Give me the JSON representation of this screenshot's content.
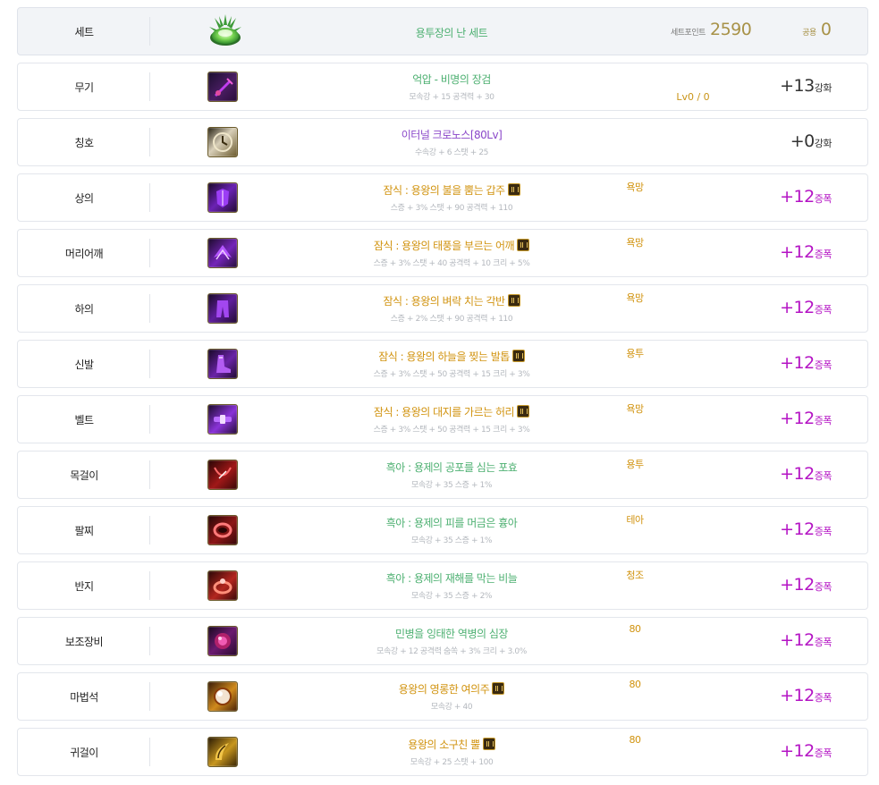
{
  "set": {
    "slot": "세트",
    "name": "용투장의 난 세트",
    "set_point_label": "세트포인트",
    "set_point": "2590",
    "shared_label": "공용",
    "shared": "0",
    "name_color": "#4db071"
  },
  "rows": [
    {
      "slot": "무기",
      "name": "억압 - 비명의 장검",
      "stat": "모속강 + 15 공격력 + 30",
      "tag": "",
      "lv": "Lv0 / 0",
      "plus": "+13",
      "suffix": "강화",
      "level_style": "dark",
      "name_style": "green",
      "badge": false,
      "icon": "sword-icon"
    },
    {
      "slot": "칭호",
      "name": "이터널 크로노스[80Lv]",
      "stat": "수속강 + 6 스탯 + 25",
      "tag": "",
      "lv": "",
      "plus": "+0",
      "suffix": "강화",
      "level_style": "dark",
      "name_style": "purple",
      "badge": false,
      "icon": "clock-icon"
    },
    {
      "slot": "상의",
      "name": "잠식 : 용왕의 불을 뿜는 갑주",
      "stat": "스증 + 3% 스탯 + 90 공격력 + 110",
      "tag": "욕망",
      "lv": "",
      "plus": "+12",
      "suffix": "증폭",
      "level_style": "pink",
      "name_style": "gold",
      "badge": true,
      "icon": "armor-icon"
    },
    {
      "slot": "머리어깨",
      "name": "잠식 : 용왕의 태풍을 부르는 어깨",
      "stat": "스증 + 3% 스탯 + 40 공격력 + 10 크리 + 5%",
      "tag": "욕망",
      "lv": "",
      "plus": "+12",
      "suffix": "증폭",
      "level_style": "pink",
      "name_style": "gold",
      "badge": true,
      "icon": "shoulder-icon"
    },
    {
      "slot": "하의",
      "name": "잠식 : 용왕의 벼락 치는 각반",
      "stat": "스증 + 2% 스탯 + 90 공격력 + 110",
      "tag": "욕망",
      "lv": "",
      "plus": "+12",
      "suffix": "증폭",
      "level_style": "pink",
      "name_style": "gold",
      "badge": true,
      "icon": "pants-icon"
    },
    {
      "slot": "신발",
      "name": "잠식 : 용왕의 하늘을 찢는 발톱",
      "stat": "스증 + 3% 스탯 + 50 공격력 + 15 크리 + 3%",
      "tag": "용투",
      "lv": "",
      "plus": "+12",
      "suffix": "증폭",
      "level_style": "pink",
      "name_style": "gold",
      "badge": true,
      "icon": "boots-icon"
    },
    {
      "slot": "벨트",
      "name": "잠식 : 용왕의 대지를 가르는 허리",
      "stat": "스증 + 3% 스탯 + 50 공격력 + 15 크리 + 3%",
      "tag": "욕망",
      "lv": "",
      "plus": "+12",
      "suffix": "증폭",
      "level_style": "pink",
      "name_style": "gold",
      "badge": true,
      "icon": "belt-icon"
    },
    {
      "slot": "목걸이",
      "name": "흑아 : 용제의 공포를 심는 포효",
      "stat": "모속강 + 35 스증 + 1%",
      "tag": "용투",
      "lv": "",
      "plus": "+12",
      "suffix": "증폭",
      "level_style": "pink",
      "name_style": "green",
      "badge": false,
      "icon": "necklace-icon"
    },
    {
      "slot": "팔찌",
      "name": "흑아 : 용제의 피를 머금은 흉아",
      "stat": "모속강 + 35 스증 + 1%",
      "tag": "테아",
      "lv": "",
      "plus": "+12",
      "suffix": "증폭",
      "level_style": "pink",
      "name_style": "green",
      "badge": false,
      "icon": "bracelet-icon"
    },
    {
      "slot": "반지",
      "name": "흑아 : 용제의 재해를 막는 비늘",
      "stat": "모속강 + 35 스증 + 2%",
      "tag": "청조",
      "lv": "",
      "plus": "+12",
      "suffix": "증폭",
      "level_style": "pink",
      "name_style": "green",
      "badge": false,
      "icon": "ring-icon"
    },
    {
      "slot": "보조장비",
      "name": "민병을 잉태한 역병의 심장",
      "stat": "모속강 + 12 공격력 숨쏙 + 3% 크리 + 3.0%",
      "tag": "80",
      "lv": "",
      "plus": "+12",
      "suffix": "증폭",
      "level_style": "pink",
      "name_style": "green",
      "badge": false,
      "icon": "heart-icon"
    },
    {
      "slot": "마법석",
      "name": "용왕의 영롱한 여의주",
      "stat": "모속강 + 40",
      "tag": "80",
      "lv": "",
      "plus": "+12",
      "suffix": "증폭",
      "level_style": "pink",
      "name_style": "gold",
      "badge": true,
      "icon": "pearl-icon"
    },
    {
      "slot": "귀걸이",
      "name": "용왕의 소구친 뿔",
      "stat": "모속강 + 25 스탯 + 100",
      "tag": "80",
      "lv": "",
      "plus": "+12",
      "suffix": "증폭",
      "level_style": "pink",
      "name_style": "gold",
      "badge": true,
      "icon": "horn-icon"
    }
  ],
  "colors": {
    "green": "#4db071",
    "purple": "#8a47c9",
    "gold": "#d1930f",
    "pink": "#b414c4"
  }
}
